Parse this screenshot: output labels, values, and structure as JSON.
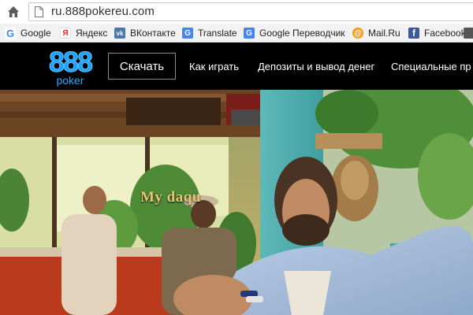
{
  "address_bar": {
    "url": "ru.888pokereu.com"
  },
  "bookmarks": [
    {
      "label": "Google",
      "icon": "google-icon",
      "color": "#4285f4",
      "glyph": "G"
    },
    {
      "label": "Яндекс",
      "icon": "yandex-icon",
      "color": "#e52620",
      "glyph": "Я"
    },
    {
      "label": "ВКонтакте",
      "icon": "vk-icon",
      "color": "#4a76a8",
      "glyph": "vk"
    },
    {
      "label": "Translate",
      "icon": "translate-icon",
      "color": "#4285f4",
      "glyph": "G"
    },
    {
      "label": "Google Переводчик",
      "icon": "translate-icon",
      "color": "#4285f4",
      "glyph": "G"
    },
    {
      "label": "Mail.Ru",
      "icon": "mailru-icon",
      "color": "#f59c1a",
      "glyph": "@"
    },
    {
      "label": "Facebook",
      "icon": "facebook-icon",
      "color": "#3b5998",
      "glyph": "f"
    }
  ],
  "site_nav": {
    "logo_number": "888",
    "logo_word": "poker",
    "download_label": "Скачать",
    "links": [
      "Как играть",
      "Депозиты и вывод денег",
      "Специальные пр"
    ]
  },
  "hero": {
    "sign_text": "My daqu"
  },
  "colors": {
    "nav_bg": "#000000",
    "brand_blue": "#1aa3ff",
    "bookmarks_bg": "#f2f2f2"
  }
}
